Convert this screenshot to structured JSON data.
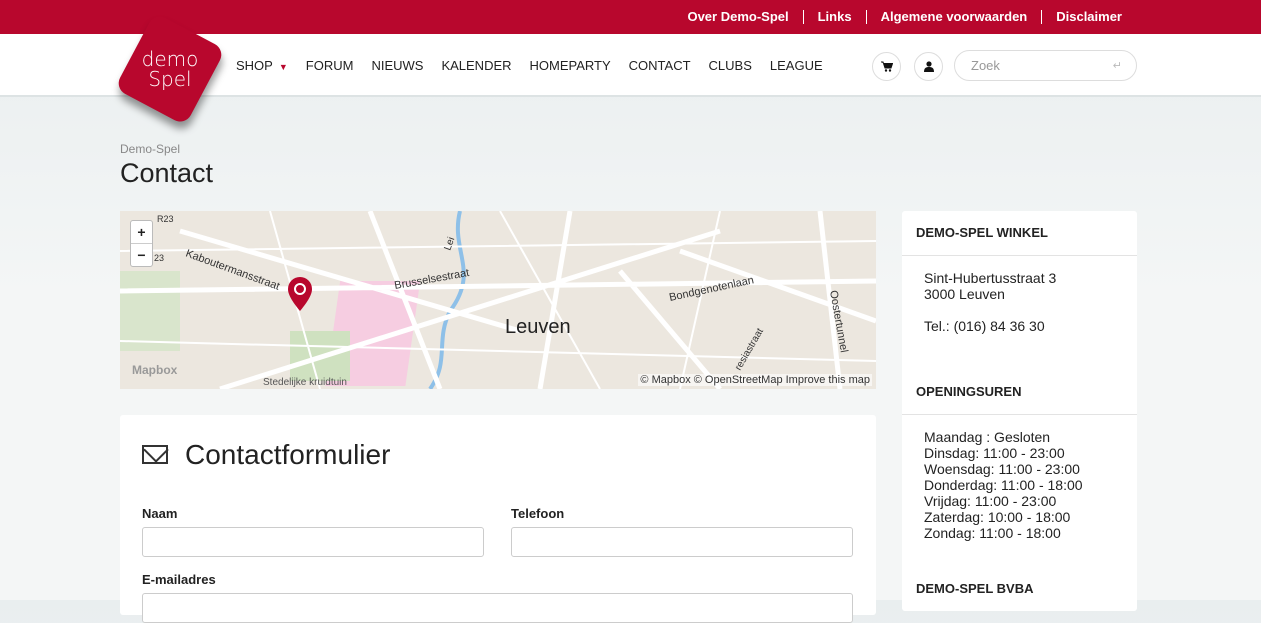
{
  "topbar": {
    "links": [
      "Over Demo-Spel",
      "Links",
      "Algemene voorwaarden",
      "Disclaimer"
    ]
  },
  "logo": {
    "text": "demo Spel"
  },
  "nav": {
    "items": [
      "SHOP",
      "FORUM",
      "NIEUWS",
      "KALENDER",
      "HOMEPARTY",
      "CONTACT",
      "CLUBS",
      "LEAGUE"
    ]
  },
  "search": {
    "placeholder": "Zoek",
    "enter_icon": "↵"
  },
  "icons": {
    "cart": "cart-icon",
    "user": "user-icon"
  },
  "breadcrumb": "Demo-Spel",
  "title": "Contact",
  "map": {
    "labels": {
      "r23": "R23",
      "r23b": "23",
      "kab": "Kaboutermansstraat",
      "brus": "Brusselsestraat",
      "lei": "Lei",
      "bond": "Bondgenotenlaan",
      "leuven": "Leuven",
      "oost": "Oostertunnel",
      "kruid": "Stedelijke kruidtuin",
      "resia": "resiastraat",
      "mapbox": "Mapbox"
    },
    "attribution": "© Mapbox © OpenStreetMap Improve this map",
    "zoom_in": "+",
    "zoom_out": "−"
  },
  "form": {
    "title": "Contactformulier",
    "fields": {
      "name": "Naam",
      "phone": "Telefoon",
      "email": "E-mailadres"
    }
  },
  "sidebar": {
    "shop": {
      "title": "DEMO-SPEL WINKEL",
      "street": "Sint-Hubertusstraat 3",
      "city": "3000 Leuven",
      "tel": "Tel.: (016) 84 36 30"
    },
    "hours": {
      "title": "OPENINGSUREN",
      "lines": [
        "Maandag : Gesloten",
        "Dinsdag: 11:00 - 23:00",
        "Woensdag: 11:00 - 23:00",
        "Donderdag: 11:00 - 18:00",
        "Vrijdag: 11:00 - 23:00",
        "Zaterdag: 10:00 - 18:00",
        "Zondag: 11:00 - 18:00"
      ]
    },
    "company": {
      "title": "DEMO-SPEL BVBA"
    }
  },
  "colors": {
    "brand": "#b8072d"
  }
}
